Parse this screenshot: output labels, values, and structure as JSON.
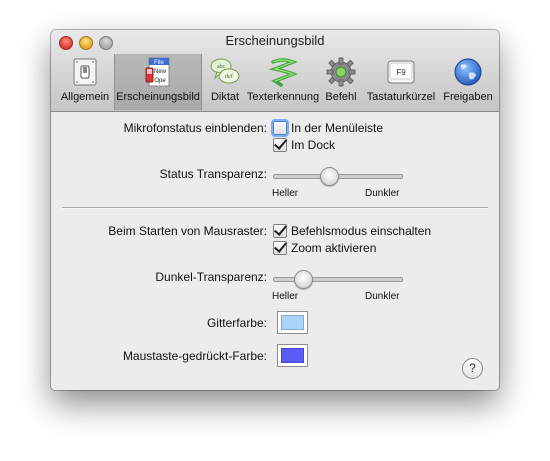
{
  "window": {
    "title": "Erscheinungsbild"
  },
  "toolbar": {
    "items": [
      {
        "label": "Allgemein",
        "icon": "switch-icon"
      },
      {
        "label": "Erscheinungsbild",
        "icon": "menu-appearance-icon",
        "selected": true
      },
      {
        "label": "Diktat",
        "icon": "speech-bubbles-icon"
      },
      {
        "label": "Texterkennung",
        "icon": "recognition-swirl-icon"
      },
      {
        "label": "Befehl",
        "icon": "cog-icon"
      },
      {
        "label": "Tastaturkürzel",
        "icon": "f9-key-icon"
      },
      {
        "label": "Freigaben",
        "icon": "globe-icon"
      }
    ],
    "key_label": "F9",
    "menu_icon_text": [
      "File",
      "New",
      "Ope"
    ]
  },
  "mic_status": {
    "label": "Mikrofonstatus einblenden:",
    "options": [
      {
        "label": "In der Menüleiste",
        "checked": false
      },
      {
        "label": "Im Dock",
        "checked": true
      }
    ]
  },
  "status_transparency": {
    "label": "Status Transparenz:",
    "value": 0.42,
    "min_label": "Heller",
    "max_label": "Dunkler"
  },
  "startup": {
    "label": "Beim Starten von Mausraster:",
    "options": [
      {
        "label": "Befehlsmodus einschalten",
        "checked": true
      },
      {
        "label": "Zoom aktivieren",
        "checked": true
      }
    ]
  },
  "dark_transparency": {
    "label": "Dunkel-Transparenz:",
    "value": 0.22,
    "min_label": "Heller",
    "max_label": "Dunkler"
  },
  "grid_color": {
    "label": "Gitterfarbe:",
    "color": "#a9d3fb"
  },
  "mouse_down_color": {
    "label": "Maustaste-gedrückt-Farbe:",
    "color": "#5a5cf5"
  },
  "help": {
    "label": "?"
  }
}
